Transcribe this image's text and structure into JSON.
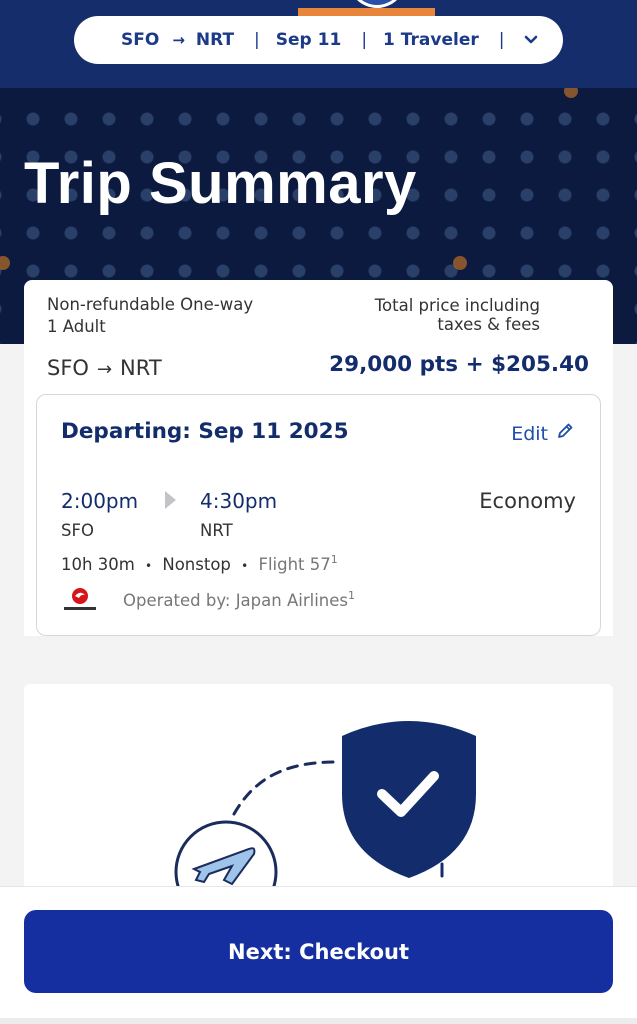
{
  "search": {
    "origin": "SFO",
    "arrow": "→",
    "destination": "NRT",
    "date": "Sep 11",
    "travelers": "1 Traveler",
    "separator": "|"
  },
  "hero": {
    "title": "Trip Summary"
  },
  "summary": {
    "fare_type": "Non-refundable One-way",
    "passengers": "1 Adult",
    "price_label_line1": "Total price including",
    "price_label_line2": "taxes & fees",
    "route_origin": "SFO",
    "route_arrow": "→",
    "route_destination": "NRT",
    "price": "29,000 pts + $205.40"
  },
  "flight": {
    "title": "Departing: Sep 11 2025",
    "edit_label": "Edit",
    "depart_time": "2:00pm",
    "depart_code": "SFO",
    "arrive_time": "4:30pm",
    "arrive_code": "NRT",
    "cabin": "Economy",
    "duration": "10h 30m",
    "bullet": "•",
    "stops": "Nonstop",
    "flight_number": "Flight 57",
    "footnote": "1",
    "operated_by": "Operated by: Japan Airlines",
    "airline_logo_text": "JAPAN AIRLINES"
  },
  "cta": {
    "next_label": "Next: Checkout"
  },
  "colors": {
    "navy": "#152d6b",
    "brand_text": "#132c6c",
    "accent_orange": "#e8853b",
    "button_blue": "#152fa0",
    "link_blue": "#1f4fa8",
    "jal_red": "#d7141a"
  },
  "icons": [
    "chevron-down-icon",
    "pencil-icon",
    "play-arrow-icon",
    "jal-crane-logo",
    "shield-check-icon",
    "plane-icon"
  ]
}
